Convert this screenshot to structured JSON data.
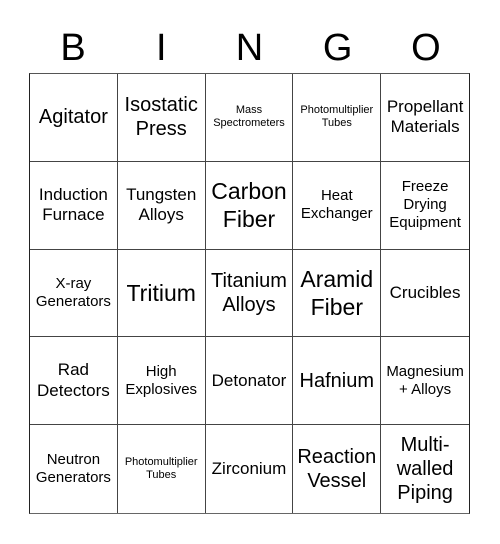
{
  "header": {
    "letters": [
      "B",
      "I",
      "N",
      "G",
      "O"
    ]
  },
  "cells": [
    {
      "text": "Agitator",
      "size": "lg"
    },
    {
      "text": "Isostatic Press",
      "size": "lg"
    },
    {
      "text": "Mass Spectrometers",
      "size": "xs"
    },
    {
      "text": "Photomultiplier Tubes",
      "size": "xs"
    },
    {
      "text": "Propellant Materials",
      "size": "md"
    },
    {
      "text": "Induction Furnace",
      "size": "md"
    },
    {
      "text": "Tungsten Alloys",
      "size": "md"
    },
    {
      "text": "Carbon Fiber",
      "size": "xl"
    },
    {
      "text": "Heat Exchanger",
      "size": "sm"
    },
    {
      "text": "Freeze Drying Equipment",
      "size": "sm"
    },
    {
      "text": "X-ray Generators",
      "size": "sm"
    },
    {
      "text": "Tritium",
      "size": "xl"
    },
    {
      "text": "Titanium Alloys",
      "size": "lg"
    },
    {
      "text": "Aramid Fiber",
      "size": "xl"
    },
    {
      "text": "Crucibles",
      "size": "md"
    },
    {
      "text": "Rad Detectors",
      "size": "md"
    },
    {
      "text": "High Explosives",
      "size": "sm"
    },
    {
      "text": "Detonator",
      "size": "md"
    },
    {
      "text": "Hafnium",
      "size": "lg"
    },
    {
      "text": "Magnesium + Alloys",
      "size": "sm"
    },
    {
      "text": "Neutron Generators",
      "size": "sm"
    },
    {
      "text": "Photomultiplier Tubes",
      "size": "xs"
    },
    {
      "text": "Zirconium",
      "size": "md"
    },
    {
      "text": "Reaction Vessel",
      "size": "lg"
    },
    {
      "text": "Multi-walled Piping",
      "size": "lg"
    }
  ]
}
